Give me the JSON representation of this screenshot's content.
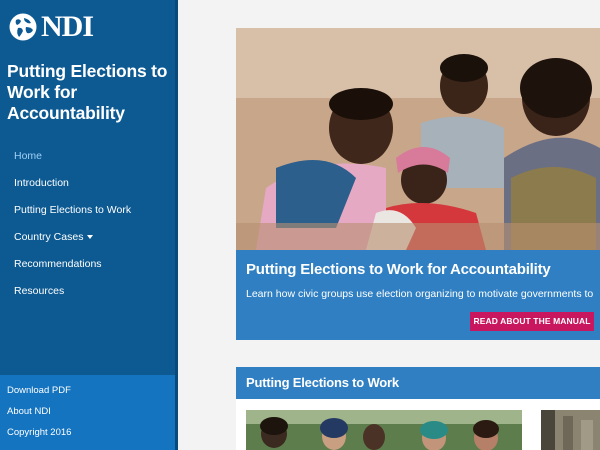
{
  "sidebar": {
    "logo_text": "NDI",
    "site_title": "Putting Elections to Work for Accountability",
    "nav": [
      {
        "label": "Home",
        "active": true
      },
      {
        "label": "Introduction"
      },
      {
        "label": "Putting Elections to Work"
      },
      {
        "label": "Country Cases",
        "has_dropdown": true
      },
      {
        "label": "Recommendations"
      },
      {
        "label": "Resources"
      }
    ],
    "footer": {
      "download": "Download PDF",
      "about": "About NDI",
      "copyright": "Copyright 2016"
    }
  },
  "hero": {
    "title": "Putting Elections to Work for Accountability",
    "description": "Learn how civic groups use election organizing to motivate governments to",
    "button_label": "READ ABOUT THE MANUAL"
  },
  "section": {
    "title": "Putting Elections to Work"
  },
  "colors": {
    "sidebar": "#0d5a93",
    "sidebar_footer": "#1474c0",
    "accent_blue": "#2f7fc2",
    "button_magenta": "#c8175f"
  }
}
